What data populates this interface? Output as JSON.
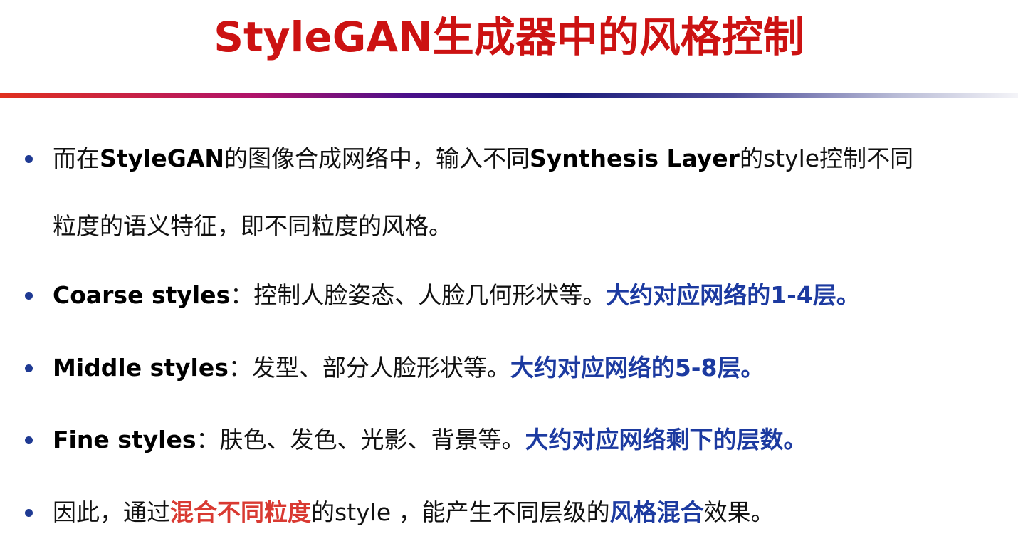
{
  "title": "StyleGAN生成器中的风格控制",
  "colors": {
    "title": "#cc1212",
    "bullet_dot": "#1f3a93",
    "blue_emphasis": "#1c3aa0",
    "red_emphasis": "#d93a32"
  },
  "bullets": [
    {
      "line1": {
        "t1": "而在",
        "b1": "StyleGAN",
        "t2": "的图像合成网络中，输入不同",
        "b2": "Synthesis Layer",
        "t3": "的style控制不同"
      },
      "line2": "粒度的语义特征，即不同粒度的风格。"
    },
    {
      "label": "Coarse styles",
      "colon": "：",
      "text": "控制人脸姿态、人脸几何形状等。",
      "emphasis": "大约对应网络的1-4层。"
    },
    {
      "label": "Middle styles",
      "colon": "：",
      "text": "发型、部分人脸形状等。",
      "emphasis": "大约对应网络的5-8层。"
    },
    {
      "label": "Fine styles",
      "colon": "：",
      "text": "肤色、发色、光影、背景等。",
      "emphasis": "大约对应网络剩下的层数。"
    },
    {
      "t1": "因此，通过",
      "red": "混合不同粒度",
      "t2": "的style ，能产生不同层级的",
      "blue": "风格混合",
      "t3": "效果。"
    }
  ]
}
